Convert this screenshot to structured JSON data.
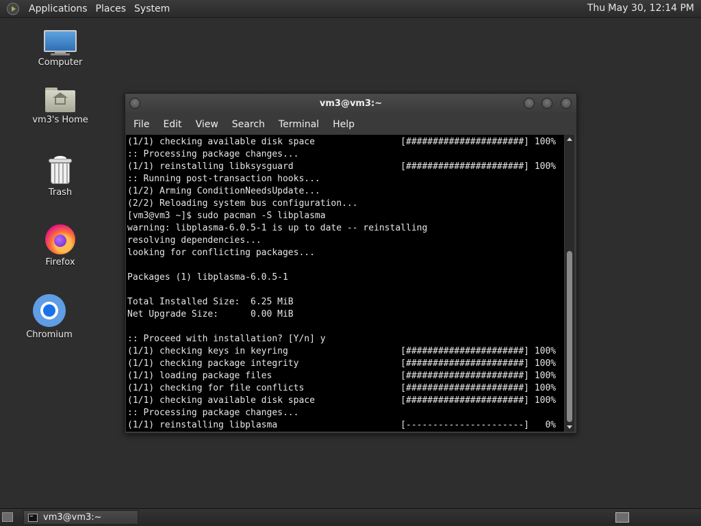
{
  "top_panel": {
    "menus": [
      "Applications",
      "Places",
      "System"
    ],
    "clock": "Thu May 30, 12:14 PM"
  },
  "desktop": {
    "icons": [
      {
        "label": "Computer",
        "icon": "computer-icon"
      },
      {
        "label": "vm3's Home",
        "icon": "home-folder-icon"
      },
      {
        "label": "Trash",
        "icon": "trash-icon"
      },
      {
        "label": "Firefox",
        "icon": "firefox-icon"
      },
      {
        "label": "Chromium",
        "icon": "chromium-icon"
      }
    ]
  },
  "terminal": {
    "title": "vm3@vm3:~",
    "menu": [
      "File",
      "Edit",
      "View",
      "Search",
      "Terminal",
      "Help"
    ],
    "lines": [
      "(1/1) checking available disk space                [######################] 100%",
      ":: Processing package changes...",
      "(1/1) reinstalling libksysguard                    [######################] 100%",
      ":: Running post-transaction hooks...",
      "(1/2) Arming ConditionNeedsUpdate...",
      "(2/2) Reloading system bus configuration...",
      "[vm3@vm3 ~]$ sudo pacman -S libplasma",
      "warning: libplasma-6.0.5-1 is up to date -- reinstalling",
      "resolving dependencies...",
      "looking for conflicting packages...",
      "",
      "Packages (1) libplasma-6.0.5-1",
      "",
      "Total Installed Size:  6.25 MiB",
      "Net Upgrade Size:      0.00 MiB",
      "",
      ":: Proceed with installation? [Y/n] y",
      "(1/1) checking keys in keyring                     [######################] 100%",
      "(1/1) checking package integrity                   [######################] 100%",
      "(1/1) loading package files                        [######################] 100%",
      "(1/1) checking for file conflicts                  [######################] 100%",
      "(1/1) checking available disk space                [######################] 100%",
      ":: Processing package changes...",
      "(1/1) reinstalling libplasma                       [----------------------]   0%"
    ]
  },
  "taskbar": {
    "window_label": "vm3@vm3:~"
  }
}
